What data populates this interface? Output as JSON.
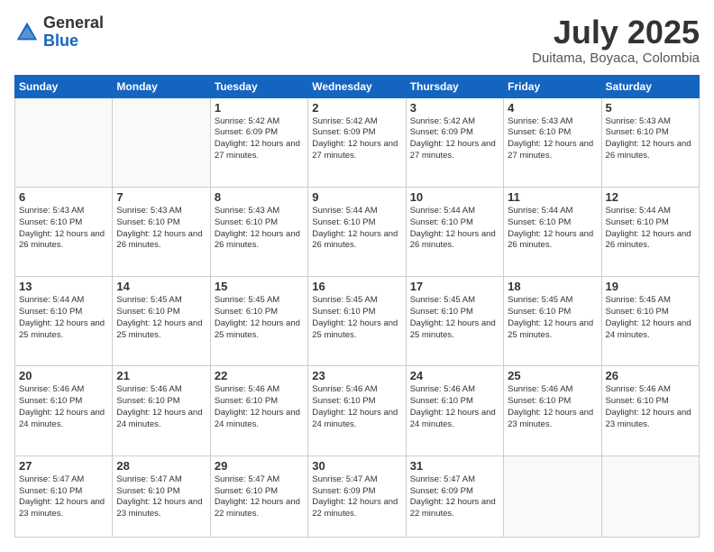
{
  "header": {
    "logo_general": "General",
    "logo_blue": "Blue",
    "month": "July 2025",
    "location": "Duitama, Boyaca, Colombia"
  },
  "days_of_week": [
    "Sunday",
    "Monday",
    "Tuesday",
    "Wednesday",
    "Thursday",
    "Friday",
    "Saturday"
  ],
  "weeks": [
    [
      {
        "day": "",
        "sunrise": "",
        "sunset": "",
        "daylight": ""
      },
      {
        "day": "",
        "sunrise": "",
        "sunset": "",
        "daylight": ""
      },
      {
        "day": "1",
        "sunrise": "Sunrise: 5:42 AM",
        "sunset": "Sunset: 6:09 PM",
        "daylight": "Daylight: 12 hours and 27 minutes."
      },
      {
        "day": "2",
        "sunrise": "Sunrise: 5:42 AM",
        "sunset": "Sunset: 6:09 PM",
        "daylight": "Daylight: 12 hours and 27 minutes."
      },
      {
        "day": "3",
        "sunrise": "Sunrise: 5:42 AM",
        "sunset": "Sunset: 6:09 PM",
        "daylight": "Daylight: 12 hours and 27 minutes."
      },
      {
        "day": "4",
        "sunrise": "Sunrise: 5:43 AM",
        "sunset": "Sunset: 6:10 PM",
        "daylight": "Daylight: 12 hours and 27 minutes."
      },
      {
        "day": "5",
        "sunrise": "Sunrise: 5:43 AM",
        "sunset": "Sunset: 6:10 PM",
        "daylight": "Daylight: 12 hours and 26 minutes."
      }
    ],
    [
      {
        "day": "6",
        "sunrise": "Sunrise: 5:43 AM",
        "sunset": "Sunset: 6:10 PM",
        "daylight": "Daylight: 12 hours and 26 minutes."
      },
      {
        "day": "7",
        "sunrise": "Sunrise: 5:43 AM",
        "sunset": "Sunset: 6:10 PM",
        "daylight": "Daylight: 12 hours and 26 minutes."
      },
      {
        "day": "8",
        "sunrise": "Sunrise: 5:43 AM",
        "sunset": "Sunset: 6:10 PM",
        "daylight": "Daylight: 12 hours and 26 minutes."
      },
      {
        "day": "9",
        "sunrise": "Sunrise: 5:44 AM",
        "sunset": "Sunset: 6:10 PM",
        "daylight": "Daylight: 12 hours and 26 minutes."
      },
      {
        "day": "10",
        "sunrise": "Sunrise: 5:44 AM",
        "sunset": "Sunset: 6:10 PM",
        "daylight": "Daylight: 12 hours and 26 minutes."
      },
      {
        "day": "11",
        "sunrise": "Sunrise: 5:44 AM",
        "sunset": "Sunset: 6:10 PM",
        "daylight": "Daylight: 12 hours and 26 minutes."
      },
      {
        "day": "12",
        "sunrise": "Sunrise: 5:44 AM",
        "sunset": "Sunset: 6:10 PM",
        "daylight": "Daylight: 12 hours and 26 minutes."
      }
    ],
    [
      {
        "day": "13",
        "sunrise": "Sunrise: 5:44 AM",
        "sunset": "Sunset: 6:10 PM",
        "daylight": "Daylight: 12 hours and 25 minutes."
      },
      {
        "day": "14",
        "sunrise": "Sunrise: 5:45 AM",
        "sunset": "Sunset: 6:10 PM",
        "daylight": "Daylight: 12 hours and 25 minutes."
      },
      {
        "day": "15",
        "sunrise": "Sunrise: 5:45 AM",
        "sunset": "Sunset: 6:10 PM",
        "daylight": "Daylight: 12 hours and 25 minutes."
      },
      {
        "day": "16",
        "sunrise": "Sunrise: 5:45 AM",
        "sunset": "Sunset: 6:10 PM",
        "daylight": "Daylight: 12 hours and 25 minutes."
      },
      {
        "day": "17",
        "sunrise": "Sunrise: 5:45 AM",
        "sunset": "Sunset: 6:10 PM",
        "daylight": "Daylight: 12 hours and 25 minutes."
      },
      {
        "day": "18",
        "sunrise": "Sunrise: 5:45 AM",
        "sunset": "Sunset: 6:10 PM",
        "daylight": "Daylight: 12 hours and 25 minutes."
      },
      {
        "day": "19",
        "sunrise": "Sunrise: 5:45 AM",
        "sunset": "Sunset: 6:10 PM",
        "daylight": "Daylight: 12 hours and 24 minutes."
      }
    ],
    [
      {
        "day": "20",
        "sunrise": "Sunrise: 5:46 AM",
        "sunset": "Sunset: 6:10 PM",
        "daylight": "Daylight: 12 hours and 24 minutes."
      },
      {
        "day": "21",
        "sunrise": "Sunrise: 5:46 AM",
        "sunset": "Sunset: 6:10 PM",
        "daylight": "Daylight: 12 hours and 24 minutes."
      },
      {
        "day": "22",
        "sunrise": "Sunrise: 5:46 AM",
        "sunset": "Sunset: 6:10 PM",
        "daylight": "Daylight: 12 hours and 24 minutes."
      },
      {
        "day": "23",
        "sunrise": "Sunrise: 5:46 AM",
        "sunset": "Sunset: 6:10 PM",
        "daylight": "Daylight: 12 hours and 24 minutes."
      },
      {
        "day": "24",
        "sunrise": "Sunrise: 5:46 AM",
        "sunset": "Sunset: 6:10 PM",
        "daylight": "Daylight: 12 hours and 24 minutes."
      },
      {
        "day": "25",
        "sunrise": "Sunrise: 5:46 AM",
        "sunset": "Sunset: 6:10 PM",
        "daylight": "Daylight: 12 hours and 23 minutes."
      },
      {
        "day": "26",
        "sunrise": "Sunrise: 5:46 AM",
        "sunset": "Sunset: 6:10 PM",
        "daylight": "Daylight: 12 hours and 23 minutes."
      }
    ],
    [
      {
        "day": "27",
        "sunrise": "Sunrise: 5:47 AM",
        "sunset": "Sunset: 6:10 PM",
        "daylight": "Daylight: 12 hours and 23 minutes."
      },
      {
        "day": "28",
        "sunrise": "Sunrise: 5:47 AM",
        "sunset": "Sunset: 6:10 PM",
        "daylight": "Daylight: 12 hours and 23 minutes."
      },
      {
        "day": "29",
        "sunrise": "Sunrise: 5:47 AM",
        "sunset": "Sunset: 6:10 PM",
        "daylight": "Daylight: 12 hours and 22 minutes."
      },
      {
        "day": "30",
        "sunrise": "Sunrise: 5:47 AM",
        "sunset": "Sunset: 6:09 PM",
        "daylight": "Daylight: 12 hours and 22 minutes."
      },
      {
        "day": "31",
        "sunrise": "Sunrise: 5:47 AM",
        "sunset": "Sunset: 6:09 PM",
        "daylight": "Daylight: 12 hours and 22 minutes."
      },
      {
        "day": "",
        "sunrise": "",
        "sunset": "",
        "daylight": ""
      },
      {
        "day": "",
        "sunrise": "",
        "sunset": "",
        "daylight": ""
      }
    ]
  ]
}
